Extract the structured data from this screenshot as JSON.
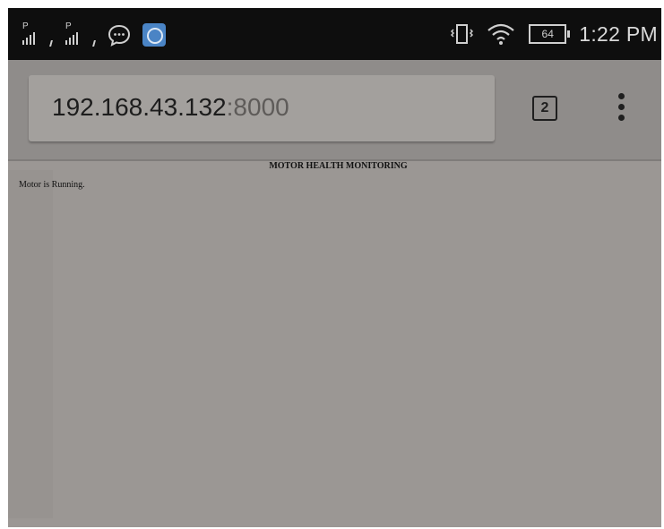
{
  "status_bar": {
    "sim1_label": "P",
    "sim2_label": "P",
    "battery": "64",
    "time": "1:22 PM",
    "icons": [
      "signal-sim1-icon",
      "signal-sim2-icon",
      "message-bubble-icon",
      "app-notification-icon",
      "vibrate-icon",
      "wifi-icon",
      "battery-icon"
    ]
  },
  "browser": {
    "url_host": "192.168.43.132",
    "url_port": ":8000",
    "tab_count": "2"
  },
  "page": {
    "title": "MOTOR HEALTH MONITORING",
    "status": "Motor is Running."
  }
}
